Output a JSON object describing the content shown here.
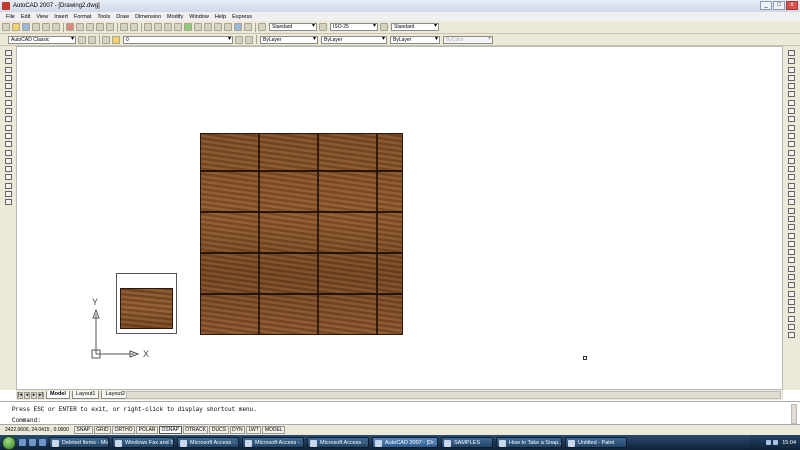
{
  "window": {
    "title": "AutoCAD 2007 - [Drawing2.dwg]",
    "buttons": [
      "_",
      "□",
      "x"
    ]
  },
  "menu": [
    "File",
    "Edit",
    "View",
    "Insert",
    "Format",
    "Tools",
    "Draw",
    "Dimension",
    "Modify",
    "Window",
    "Help",
    "Express"
  ],
  "toolbar1": {
    "text_style": "Standard",
    "dim_style": "ISO-25",
    "table_style": "Standard"
  },
  "toolbar2": {
    "workspace": "AutoCAD Classic",
    "layer": "0",
    "color": "ByLayer",
    "linetype": "ByLayer",
    "lineweight": "ByLayer",
    "plot_style": "ByColor"
  },
  "ucs": {
    "x_label": "X",
    "y_label": "Y"
  },
  "layout_tabs": [
    "Model",
    "Layout1",
    "Layout2"
  ],
  "command": {
    "history": "Press ESC or ENTER to exit, or right-click to display shortcut menu.",
    "prompt": "Command:"
  },
  "status": {
    "coords": "2422.0606, 24.0415 , 0.0000",
    "toggles": [
      "SNAP",
      "GRID",
      "ORTHO",
      "POLAR",
      "OSNAP",
      "OTRACK",
      "DUCS",
      "DYN",
      "LWT",
      "MODEL"
    ]
  },
  "taskbar": {
    "tasks": [
      "Deleted Items - Micr...",
      "Windows Fax and Sc...",
      "Microsoft Access - ...",
      "Microsoft Access - ...",
      "Microsoft Access - ...",
      "AutoCAD 2007 - [Dr...",
      "SAMPLES",
      "How to Take a Snap...",
      "Untitled - Paint"
    ],
    "clock": "15:04"
  }
}
